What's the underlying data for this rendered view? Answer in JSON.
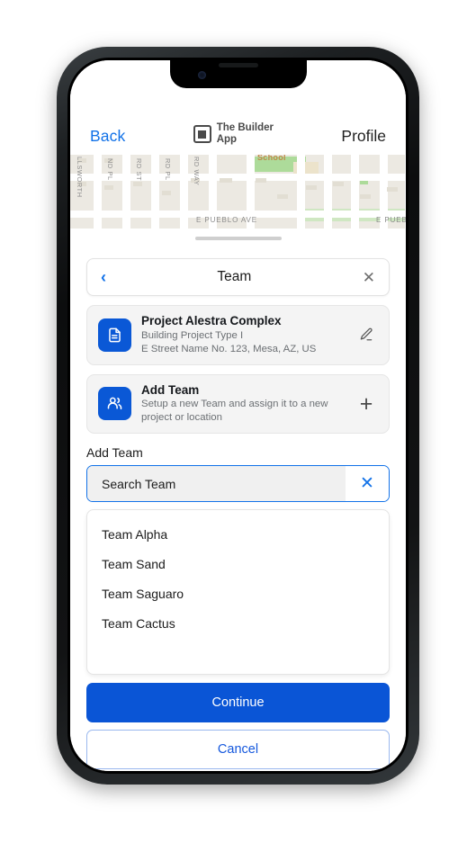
{
  "device": {
    "type": "smartphone",
    "notch": true
  },
  "header": {
    "back_label": "Back",
    "brand_line1": "The Builder",
    "brand_line2": "App",
    "profile_label": "Profile"
  },
  "map": {
    "vertical_streets": [
      "LLSWORTH",
      "ND PL",
      "RD ST",
      "RD PL",
      "RD WAY"
    ],
    "horizontal_streets": [
      "E PUEBLO AVE",
      "E PUEB"
    ],
    "poi": "School"
  },
  "sheet": {
    "title": "Team",
    "back_icon": "‹",
    "close_icon": "✕",
    "project_card": {
      "title": "Project Alestra Complex",
      "subtitle": "Building Project Type I",
      "address": "E Street Name No. 123, Mesa, AZ, US",
      "icon": "document-icon",
      "action_icon": "edit-pencil-icon"
    },
    "add_team_card": {
      "title": "Add Team",
      "subtitle_line1": "Setup a new Team and assign it to a new",
      "subtitle_line2": "project or location",
      "icon": "people-group-icon",
      "action_icon": "plus-icon",
      "action_label": "+"
    },
    "add_team_section_label": "Add Team",
    "search": {
      "value": "Search Team",
      "placeholder": "Search Team",
      "clear_label": "✕"
    },
    "results": [
      {
        "label": "Team Alpha"
      },
      {
        "label": "Team Sand"
      },
      {
        "label": "Team Saguaro"
      },
      {
        "label": "Team Cactus"
      }
    ],
    "continue_label": "Continue",
    "cancel_label": "Cancel"
  },
  "colors": {
    "primary_blue": "#0a55d6",
    "link_blue": "#1272e8",
    "icon_blue": "#0a58d6",
    "card_bg": "#f4f4f4",
    "map_bg": "#f2efe9"
  }
}
